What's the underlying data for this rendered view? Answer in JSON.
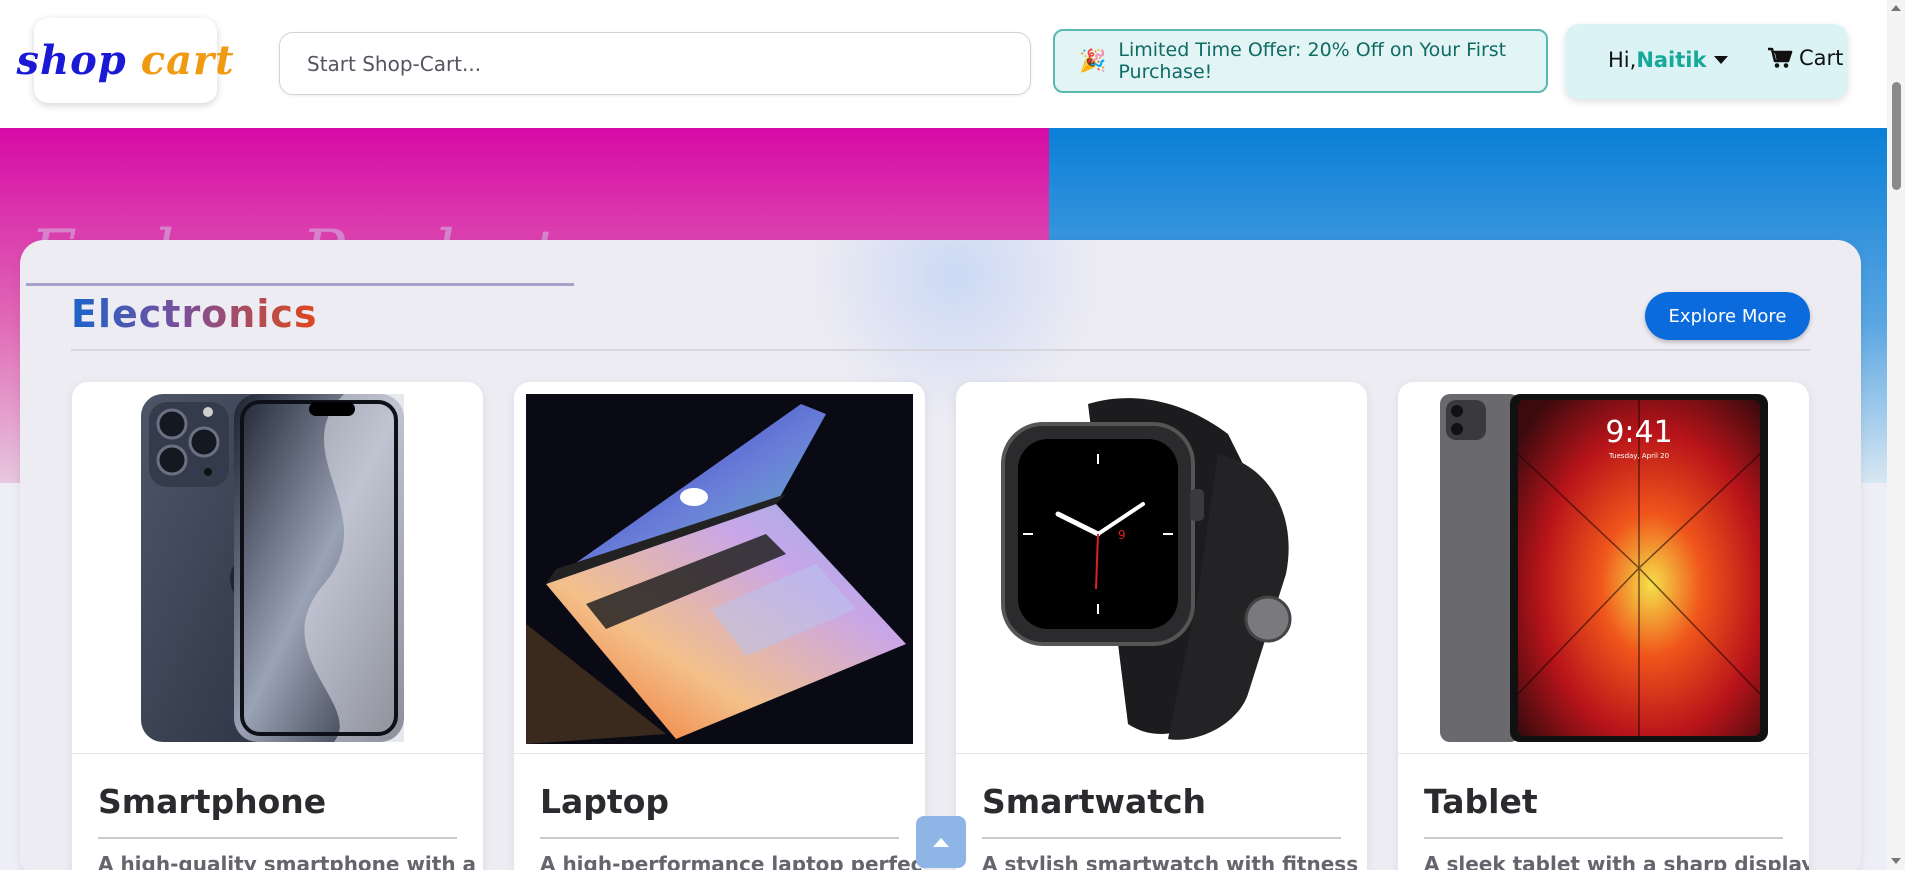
{
  "header": {
    "logo_word1": "shop",
    "logo_word2": "cart",
    "search_placeholder": "Start Shop-Cart...",
    "offer_icon": "party-popper-icon",
    "offer_text": "Limited Time Offer: 20% Off on Your First Purchase!",
    "greeting": "Hi,",
    "username": "Naitik",
    "cart_label": "Cart"
  },
  "hero": {
    "title": "Explore Products"
  },
  "section": {
    "title": "Electronics",
    "explore_label": "Explore More"
  },
  "products": [
    {
      "name": "Smartphone",
      "desc": "A high-quality smartphone with a"
    },
    {
      "name": "Laptop",
      "desc": "A high-performance laptop perfect"
    },
    {
      "name": "Smartwatch",
      "desc": "A stylish smartwatch with fitness"
    },
    {
      "name": "Tablet",
      "desc": "A sleek tablet with a sharp display"
    }
  ],
  "colors": {
    "brand_blue": "#1a1ad6",
    "brand_orange": "#f09a12",
    "accent_teal": "#17a89a",
    "button_blue": "#0c6bdc"
  }
}
